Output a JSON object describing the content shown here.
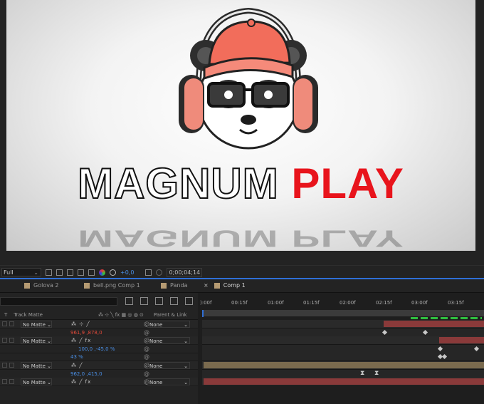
{
  "composition": {
    "headline_word1": "MAGNUM",
    "headline_word2": "PLAY",
    "colors": {
      "white_text": "#ffffff",
      "red_text": "#e8141c",
      "cap": "#f26d5b",
      "headphones": "#ef8b7b"
    }
  },
  "viewer_bar": {
    "resolution": "Full",
    "exposure": "+0,0",
    "timecode": "0;00;04;14"
  },
  "tabs": [
    {
      "label": "Golova 2",
      "active": false
    },
    {
      "label": "bell.png Comp 1",
      "active": false
    },
    {
      "label": "Panda",
      "active": false
    },
    {
      "label": "Comp 1",
      "active": true
    }
  ],
  "columns": {
    "t": "T",
    "track_matte": "Track Matte",
    "parent_link": "Parent & Link"
  },
  "layers": [
    {
      "matte": "No Matte",
      "switches": "⁂ ⊹ ╱",
      "parent": "None"
    },
    {
      "property_value": "961,9 ,878,0"
    },
    {
      "matte": "No Matte",
      "switches": "⁂ ╱ fx",
      "parent": "None"
    },
    {
      "property_value": "100,0 ,-45,0 %"
    },
    {
      "property_value": "43 %"
    },
    {
      "matte": "No Matte",
      "switches": "⁂ ╱",
      "parent": "None"
    },
    {
      "property_value": "962,0 ,415,0"
    },
    {
      "matte": "No Matte",
      "switches": "⁂ ╱ fx",
      "parent": "None"
    }
  ],
  "ruler": [
    "):00f",
    "00:15f",
    "01:00f",
    "01:15f",
    "02:00f",
    "02:15f",
    "03:00f",
    "03:15f"
  ],
  "icons": [
    "search-icon",
    "graph-editor-icon",
    "motion-blur-icon",
    "camera-icon",
    "spiral-link-icon"
  ]
}
